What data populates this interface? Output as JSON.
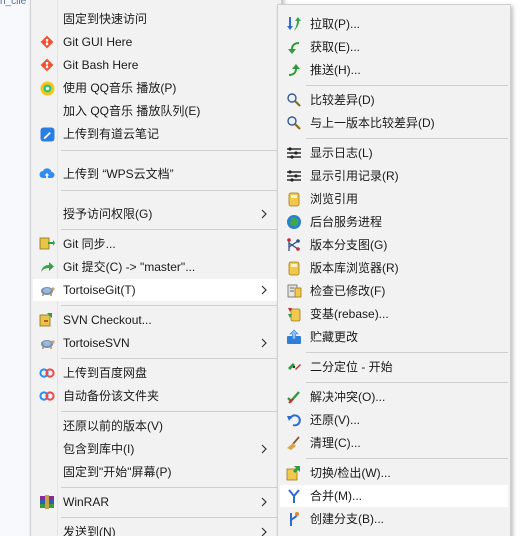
{
  "background": {
    "text": "n_clie"
  },
  "main_menu": {
    "items": [
      {
        "label": "固定到快速访问",
        "icon": "none"
      },
      {
        "label": "Git GUI Here",
        "icon": "git-diamond-icon"
      },
      {
        "label": "Git Bash Here",
        "icon": "git-diamond-icon"
      },
      {
        "label": "使用 QQ音乐 播放(P)",
        "icon": "qq-music-icon"
      },
      {
        "label": "加入 QQ音乐 播放队列(E)",
        "icon": "none"
      },
      {
        "label": "上传到有道云笔记",
        "icon": "youdao-note-icon"
      },
      {
        "label": "上传到 “WPS云文档”",
        "icon": "cloud-upload-icon"
      },
      {
        "label": "授予访问权限(G)",
        "icon": "none",
        "submenu": true
      },
      {
        "label": "Git 同步...",
        "icon": "git-sync-icon"
      },
      {
        "label": "Git 提交(C) -> \"master\"...",
        "icon": "git-commit-icon"
      },
      {
        "label": "TortoiseGit(T)",
        "icon": "tortoisegit-icon",
        "submenu": true,
        "highlighted": true
      },
      {
        "label": "SVN Checkout...",
        "icon": "svn-checkout-icon"
      },
      {
        "label": "TortoiseSVN",
        "icon": "tortoisesvn-icon",
        "submenu": true
      },
      {
        "label": "上传到百度网盘",
        "icon": "baidu-pan-icon"
      },
      {
        "label": "自动备份该文件夹",
        "icon": "baidu-pan-icon"
      },
      {
        "label": "还原以前的版本(V)",
        "icon": "none"
      },
      {
        "label": "包含到库中(I)",
        "icon": "none",
        "submenu": true
      },
      {
        "label": "固定到\"开始\"屏幕(P)",
        "icon": "none"
      },
      {
        "label": "WinRAR",
        "icon": "winrar-icon",
        "submenu": true
      },
      {
        "label": "发送到(N)",
        "icon": "none",
        "submenu": true
      }
    ]
  },
  "sub_menu": {
    "items": [
      {
        "label": "拉取(P)...",
        "icon": "pull-icon"
      },
      {
        "label": "获取(E)...",
        "icon": "fetch-icon"
      },
      {
        "label": "推送(H)...",
        "icon": "push-icon"
      },
      {
        "label": "比较差异(D)",
        "icon": "diff-magnifier-icon"
      },
      {
        "label": "与上一版本比较差异(D)",
        "icon": "diff-magnifier-icon"
      },
      {
        "label": "显示日志(L)",
        "icon": "log-icon"
      },
      {
        "label": "显示引用记录(R)",
        "icon": "reflog-icon"
      },
      {
        "label": "浏览引用",
        "icon": "browse-refs-icon"
      },
      {
        "label": "后台服务进程",
        "icon": "globe-icon"
      },
      {
        "label": "版本分支图(G)",
        "icon": "revision-graph-icon"
      },
      {
        "label": "版本库浏览器(R)",
        "icon": "repo-browser-icon"
      },
      {
        "label": "检查已修改(F)",
        "icon": "check-modifications-icon"
      },
      {
        "label": "变基(rebase)...",
        "icon": "rebase-icon"
      },
      {
        "label": "贮藏更改",
        "icon": "stash-icon"
      },
      {
        "label": "二分定位 - 开始",
        "icon": "bisect-icon"
      },
      {
        "label": "解决冲突(O)...",
        "icon": "resolve-icon"
      },
      {
        "label": "还原(V)...",
        "icon": "revert-icon"
      },
      {
        "label": "清理(C)...",
        "icon": "cleanup-icon"
      },
      {
        "label": "切换/检出(W)...",
        "icon": "switch-icon"
      },
      {
        "label": "合并(M)...",
        "icon": "merge-icon",
        "highlighted": true
      },
      {
        "label": "创建分支(B)...",
        "icon": "branch-icon"
      }
    ]
  }
}
